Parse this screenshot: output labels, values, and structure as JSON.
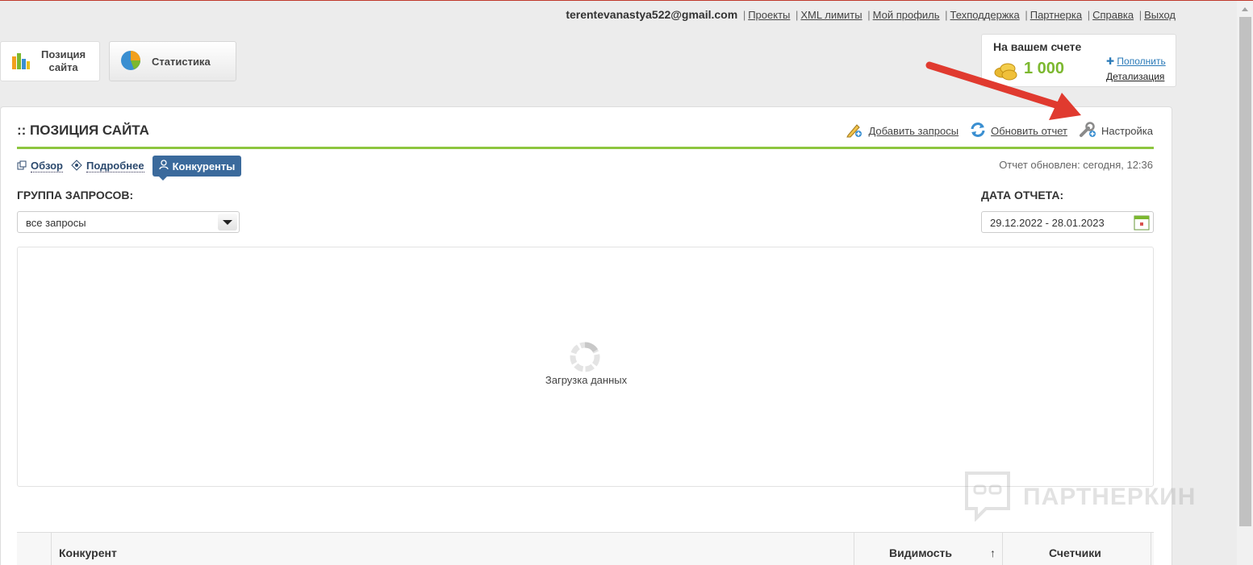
{
  "topbar": {
    "email": "terentevanastya522@gmail.com",
    "links": [
      "Проекты",
      "XML лимиты",
      "Мой профиль",
      "Техподдержка",
      "Партнерка",
      "Справка",
      "Выход"
    ]
  },
  "nav": {
    "position_line1": "Позиция",
    "position_line2": "сайта",
    "statistics": "Статистика"
  },
  "balance": {
    "title": "На вашем счете",
    "amount": "1 000",
    "topup": "Пополнить",
    "details": "Детализация"
  },
  "panel": {
    "title": ":: ПОЗИЦИЯ САЙТА",
    "add_queries": "Добавить запросы",
    "refresh_report": "Обновить отчет",
    "settings": "Настройка",
    "tabs": [
      "Обзор",
      "Подробнее",
      "Конкуренты"
    ],
    "active_tab": "Конкуренты",
    "updated": "Отчет обновлен: сегодня, 12:36",
    "group_label": "ГРУППА ЗАПРОСОВ:",
    "group_value": "все запросы",
    "date_label": "ДАТА ОТЧЕТА:",
    "date_value": "29.12.2022 - 28.01.2023",
    "loading": "Загрузка данных"
  },
  "table": {
    "headers": [
      "Конкурент",
      "Видимость",
      "Счетчики"
    ],
    "sort_indicator": "↑"
  },
  "watermark": "ПАРТНЕРКИН",
  "colors": {
    "accent_green": "#8dc63f",
    "active_tab": "#3b6a9c",
    "amount": "#7cb82f",
    "annotation_arrow": "#e03a2f"
  }
}
